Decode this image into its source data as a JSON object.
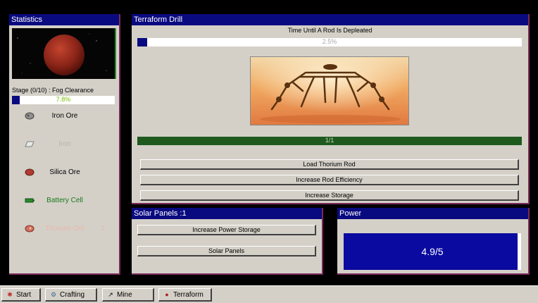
{
  "statistics": {
    "title": "Statistics",
    "stage_label": "Stage (0/10) : Fog Clearance",
    "stage_progress": 7.8,
    "stage_progress_text": "7.8%",
    "resources": [
      {
        "name": "Iron Ore",
        "icon": "iron-ore-icon",
        "color": "#000000",
        "qty": ""
      },
      {
        "name": "Iron",
        "icon": "iron-ingot-icon",
        "color": "#b8b4ac",
        "qty": ""
      },
      {
        "name": "Silica Ore",
        "icon": "silica-ore-icon",
        "color": "#000000",
        "qty": ""
      },
      {
        "name": "Battery Cell",
        "icon": "battery-icon",
        "color": "#1a7a1a",
        "qty": ""
      },
      {
        "name": "Thorium Ore",
        "icon": "thorium-ore-icon",
        "color": "#e8b8a8",
        "qty": "1"
      }
    ]
  },
  "terraform": {
    "title": "Terraform Drill",
    "timer_label": "Time Until A Rod Is Depleated",
    "rod_progress": 2.5,
    "rod_progress_text": "2.5%",
    "rods_text": "1/1",
    "rods_fill": 1.0,
    "buttons": {
      "load": "Load Thorium Rod",
      "efficiency": "Increase Rod Efficiency",
      "storage": "Increase Storage"
    }
  },
  "solar": {
    "title": "Solar Panels :1",
    "buttons": {
      "power_storage": "Increase Power Storage",
      "panels": "Solar Panels"
    }
  },
  "power": {
    "title": "Power",
    "value_text": "4.9/5",
    "fill": 0.98
  },
  "taskbar": {
    "items": [
      {
        "label": "Start",
        "icon": "start-icon"
      },
      {
        "label": "Crafting",
        "icon": "crafting-icon"
      },
      {
        "label": "Mine",
        "icon": "pickaxe-icon"
      },
      {
        "label": "Terraform",
        "icon": "terraform-icon"
      }
    ]
  },
  "colors": {
    "titlebar": "#0a0a80",
    "panel": "#d4d0c8",
    "rod_bar": "#1e5a1e",
    "power_box": "#0a0aa0",
    "stage_text": "#7ac000"
  }
}
